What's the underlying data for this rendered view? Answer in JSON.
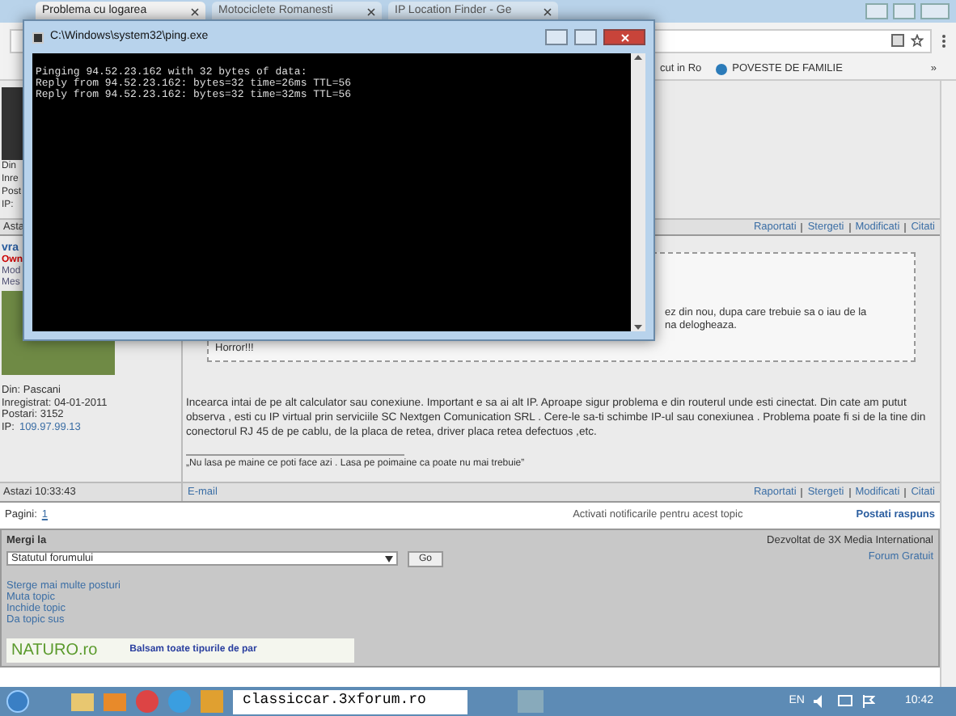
{
  "browser": {
    "tabs": [
      {
        "label": "Problema cu logarea",
        "selected": true
      },
      {
        "label": "Motociclete Romanesti",
        "selected": false
      },
      {
        "label": "IP Location Finder - Ge",
        "selected": false
      }
    ],
    "bookmarks": [
      "cut in Ro",
      "POVESTE DE FAMILIE"
    ],
    "bookmarks_more": "»"
  },
  "post_top": {
    "author_lines": [
      "Din",
      "Inre",
      "Post",
      "IP:"
    ],
    "footer_left": "Asta",
    "footer_links": [
      "Raportati",
      "Stergeti",
      "Modificati",
      "Citati"
    ]
  },
  "post_main": {
    "username": "vra",
    "rank": "Own",
    "author_lines": [
      "Mod",
      "Mes"
    ],
    "details": [
      "Din: Pascani",
      "Inregistrat: 04-01-2011",
      "Postari: 3152"
    ],
    "ip_label": "IP:",
    "ip": "109.97.99.13",
    "quote_lines": [
      "ez din nou, dupa care trebuie sa o iau de la",
      "na delogheaza."
    ],
    "quote_end": "Horror!!!",
    "body": "Incearca intai de pe alt calculator sau conexiune. Important e sa ai alt IP. Aproape sigur problema e din routerul unde esti cinectat. Din cate am putut observa , esti cu IP virtual prin serviciile SC Nextgen Comunication SRL . Cere-le sa-ti schimbe IP-ul sau conexiunea . Problema poate fi si de la tine din conectorul RJ 45 de pe cablu, de la placa de retea, driver placa retea defectuos ,etc.",
    "signature": "„Nu lasa pe maine ce poti face azi . Lasa pe poimaine ca poate nu mai trebuie”",
    "footer_left": "Astazi 10:33:43",
    "footer_email": "E-mail",
    "footer_links": [
      "Raportati",
      "Stergeti",
      "Modificati",
      "Citati"
    ]
  },
  "pagination": {
    "label": "Pagini:",
    "page": "1"
  },
  "notify_link": "Activati notificarile pentru acest topic",
  "reply_link": "Postati raspuns",
  "jump": {
    "label": "Mergi la",
    "value": "Statutul forumului",
    "go": "Go"
  },
  "credits": [
    "Dezvoltat de 3X Media International",
    "Forum Gratuit"
  ],
  "mod_links": [
    "Sterge mai multe posturi",
    "Muta topic",
    "Inchide topic",
    "Da topic sus"
  ],
  "banner": {
    "logo": "NATURO.ro",
    "text": "Balsam toate tipurile de par"
  },
  "console": {
    "title": "C:\\Windows\\system32\\ping.exe",
    "lines": [
      "Pinging 94.52.23.162 with 32 bytes of data:",
      "Reply from 94.52.23.162: bytes=32 time=26ms TTL=56",
      "Reply from 94.52.23.162: bytes=32 time=32ms TTL=56"
    ]
  },
  "taskbar": {
    "pinned_label": "classiccar.3xforum.ro",
    "language": "EN",
    "time": "10:42"
  }
}
